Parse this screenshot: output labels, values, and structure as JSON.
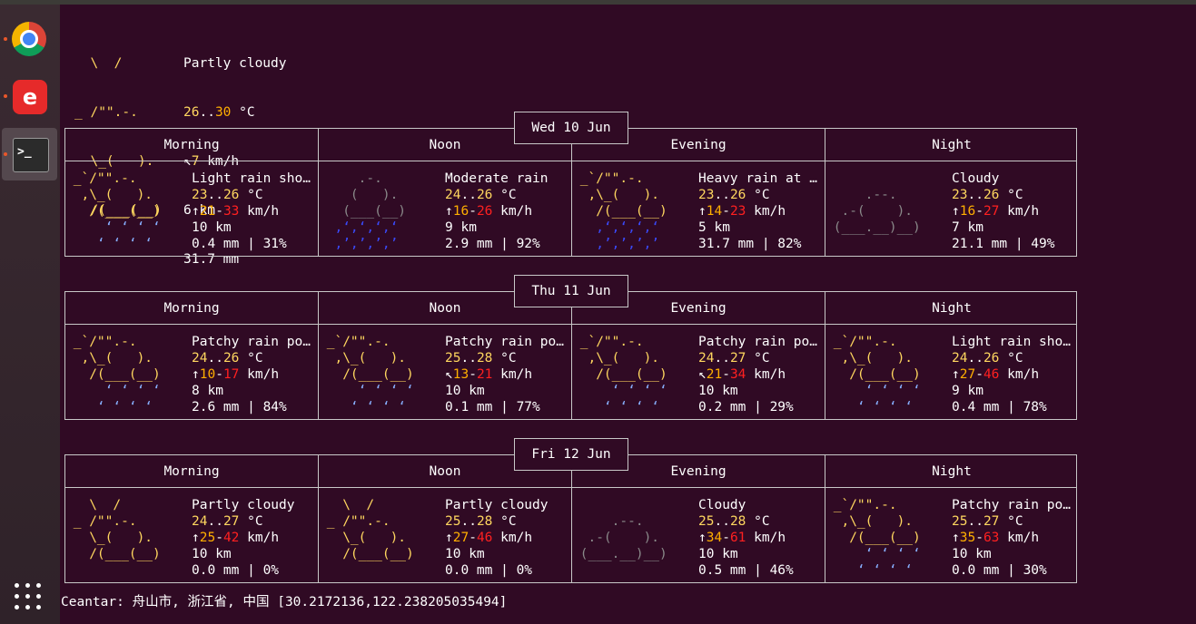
{
  "dock": {
    "items": [
      {
        "name": "Google Chrome",
        "icon": "chrome-icon",
        "running": true
      },
      {
        "name": "NetEase Cloud Music",
        "icon": "netease-music-icon",
        "running": true
      },
      {
        "name": "Terminal",
        "icon": "terminal-icon",
        "running": true,
        "active": true
      }
    ],
    "show_apps_icon": "grid-icon"
  },
  "colors": {
    "background": "#300a24",
    "yellow": "#ffd75f",
    "orange": "#ffaf00",
    "red": "#ff2020",
    "blue": "#3a4bff",
    "light_blue": "#87afff",
    "gray": "#8a8a8a"
  },
  "current": {
    "art": [
      "  \\  /      ",
      "_ /\"\".-.    ",
      "  \\_(   ).  ",
      "  /(___(__) "
    ],
    "condition": "Partly cloudy",
    "temp_low": "26",
    "temp_high": "30",
    "temp_unit": " °C",
    "wind_arrow": "↖",
    "wind": "7",
    "wind_unit": " km/h",
    "visibility": "6 km",
    "precip": "31.7 mm"
  },
  "days": [
    {
      "date": "Wed 10 Jun",
      "periods": [
        {
          "label": "Morning",
          "art_type": "light-rain",
          "art": [
            " _`/\"\".-.    ",
            "  ,\\_(   ).  ",
            "   /(___(__) ",
            "     ‘ ‘ ‘ ‘ ",
            "    ‘ ‘ ‘ ‘  "
          ],
          "condition": "Light rain sho…",
          "t1": "23",
          "t2": "26",
          "wind_arrow": "↑",
          "w1": "21",
          "w2": "33",
          "vis": "10 km",
          "precip": "0.4 mm | 31%"
        },
        {
          "label": "Noon",
          "art_type": "heavy-rain",
          "art": [
            "     .-.     ",
            "    (   ).   ",
            "   (___(__)  ",
            "  ‚‘‚‘‚‘‚‘   ",
            "  ‚’‚’‚’‚’   "
          ],
          "condition": "Moderate rain",
          "t1": "24",
          "t2": "26",
          "wind_arrow": "↑",
          "w1": "16",
          "w2": "26",
          "vis": "9 km",
          "precip": "2.9 mm | 92%"
        },
        {
          "label": "Evening",
          "art_type": "heavy-rain-shower",
          "art": [
            " _`/\"\".-.    ",
            "  ,\\_(   ).  ",
            "   /(___(__) ",
            "   ‚‘‚‘‚‘‚‘  ",
            "   ‚’‚’‚’‚’  "
          ],
          "condition": "Heavy rain at …",
          "t1": "23",
          "t2": "26",
          "wind_arrow": "↑",
          "w1": "14",
          "w2": "23",
          "vis": "5 km",
          "precip": "31.7 mm | 82%"
        },
        {
          "label": "Night",
          "art_type": "cloudy",
          "art": [
            "             ",
            "     .--.    ",
            "  .-(    ).  ",
            " (___.__)__) ",
            "             "
          ],
          "condition": "Cloudy",
          "t1": "23",
          "t2": "26",
          "wind_arrow": "↑",
          "w1": "16",
          "w2": "27",
          "vis": "7 km",
          "precip": "21.1 mm | 49%"
        }
      ]
    },
    {
      "date": "Thu 11 Jun",
      "periods": [
        {
          "label": "Morning",
          "art_type": "light-rain",
          "art": [
            " _`/\"\".-.    ",
            "  ,\\_(   ).  ",
            "   /(___(__) ",
            "     ‘ ‘ ‘ ‘ ",
            "    ‘ ‘ ‘ ‘  "
          ],
          "condition": "Patchy rain po…",
          "t1": "24",
          "t2": "26",
          "wind_arrow": "↑",
          "w1": "10",
          "w2": "17",
          "vis": "8 km",
          "precip": "2.6 mm | 84%"
        },
        {
          "label": "Noon",
          "art_type": "light-rain",
          "art": [
            " _`/\"\".-.    ",
            "  ,\\_(   ).  ",
            "   /(___(__) ",
            "     ‘ ‘ ‘ ‘ ",
            "    ‘ ‘ ‘ ‘  "
          ],
          "condition": "Patchy rain po…",
          "t1": "25",
          "t2": "28",
          "wind_arrow": "↖",
          "w1": "13",
          "w2": "21",
          "vis": "10 km",
          "precip": "0.1 mm | 77%"
        },
        {
          "label": "Evening",
          "art_type": "light-rain",
          "art": [
            " _`/\"\".-.    ",
            "  ,\\_(   ).  ",
            "   /(___(__) ",
            "     ‘ ‘ ‘ ‘ ",
            "    ‘ ‘ ‘ ‘  "
          ],
          "condition": "Patchy rain po…",
          "t1": "24",
          "t2": "27",
          "wind_arrow": "↖",
          "w1": "21",
          "w2": "34",
          "vis": "10 km",
          "precip": "0.2 mm | 29%"
        },
        {
          "label": "Night",
          "art_type": "light-rain",
          "art": [
            " _`/\"\".-.    ",
            "  ,\\_(   ).  ",
            "   /(___(__) ",
            "     ‘ ‘ ‘ ‘ ",
            "    ‘ ‘ ‘ ‘  "
          ],
          "condition": "Light rain sho…",
          "t1": "24",
          "t2": "26",
          "wind_arrow": "↑",
          "w1": "27",
          "w2": "46",
          "vis": "9 km",
          "precip": "0.4 mm | 78%"
        }
      ]
    },
    {
      "date": "Fri 12 Jun",
      "periods": [
        {
          "label": "Morning",
          "art_type": "partly-cloudy",
          "art": [
            "   \\  /      ",
            " _ /\"\".-.    ",
            "   \\_(   ).  ",
            "   /(___(__) ",
            "             "
          ],
          "condition": "Partly cloudy",
          "t1": "24",
          "t2": "27",
          "wind_arrow": "↑",
          "w1": "25",
          "w2": "42",
          "vis": "10 km",
          "precip": "0.0 mm | 0%"
        },
        {
          "label": "Noon",
          "art_type": "partly-cloudy",
          "art": [
            "   \\  /      ",
            " _ /\"\".-.    ",
            "   \\_(   ).  ",
            "   /(___(__) ",
            "             "
          ],
          "condition": "Partly cloudy",
          "t1": "25",
          "t2": "28",
          "wind_arrow": "↑",
          "w1": "27",
          "w2": "46",
          "vis": "10 km",
          "precip": "0.0 mm | 0%"
        },
        {
          "label": "Evening",
          "art_type": "cloudy",
          "art": [
            "             ",
            "     .--.    ",
            "  .-(    ).  ",
            " (___.__)__) ",
            "             "
          ],
          "condition": "Cloudy",
          "t1": "25",
          "t2": "28",
          "wind_arrow": "↑",
          "w1": "34",
          "w2": "61",
          "vis": "10 km",
          "precip": "0.5 mm | 46%"
        },
        {
          "label": "Night",
          "art_type": "light-rain",
          "art": [
            " _`/\"\".-.    ",
            "  ,\\_(   ).  ",
            "   /(___(__) ",
            "     ‘ ‘ ‘ ‘ ",
            "    ‘ ‘ ‘ ‘  "
          ],
          "condition": "Patchy rain po…",
          "t1": "25",
          "t2": "27",
          "wind_arrow": "↑",
          "w1": "35",
          "w2": "63",
          "vis": "10 km",
          "precip": "0.0 mm | 30%"
        }
      ]
    }
  ],
  "location": "Ceantar: 舟山市, 浙江省, 中国 [30.2172136,122.238205035494]"
}
